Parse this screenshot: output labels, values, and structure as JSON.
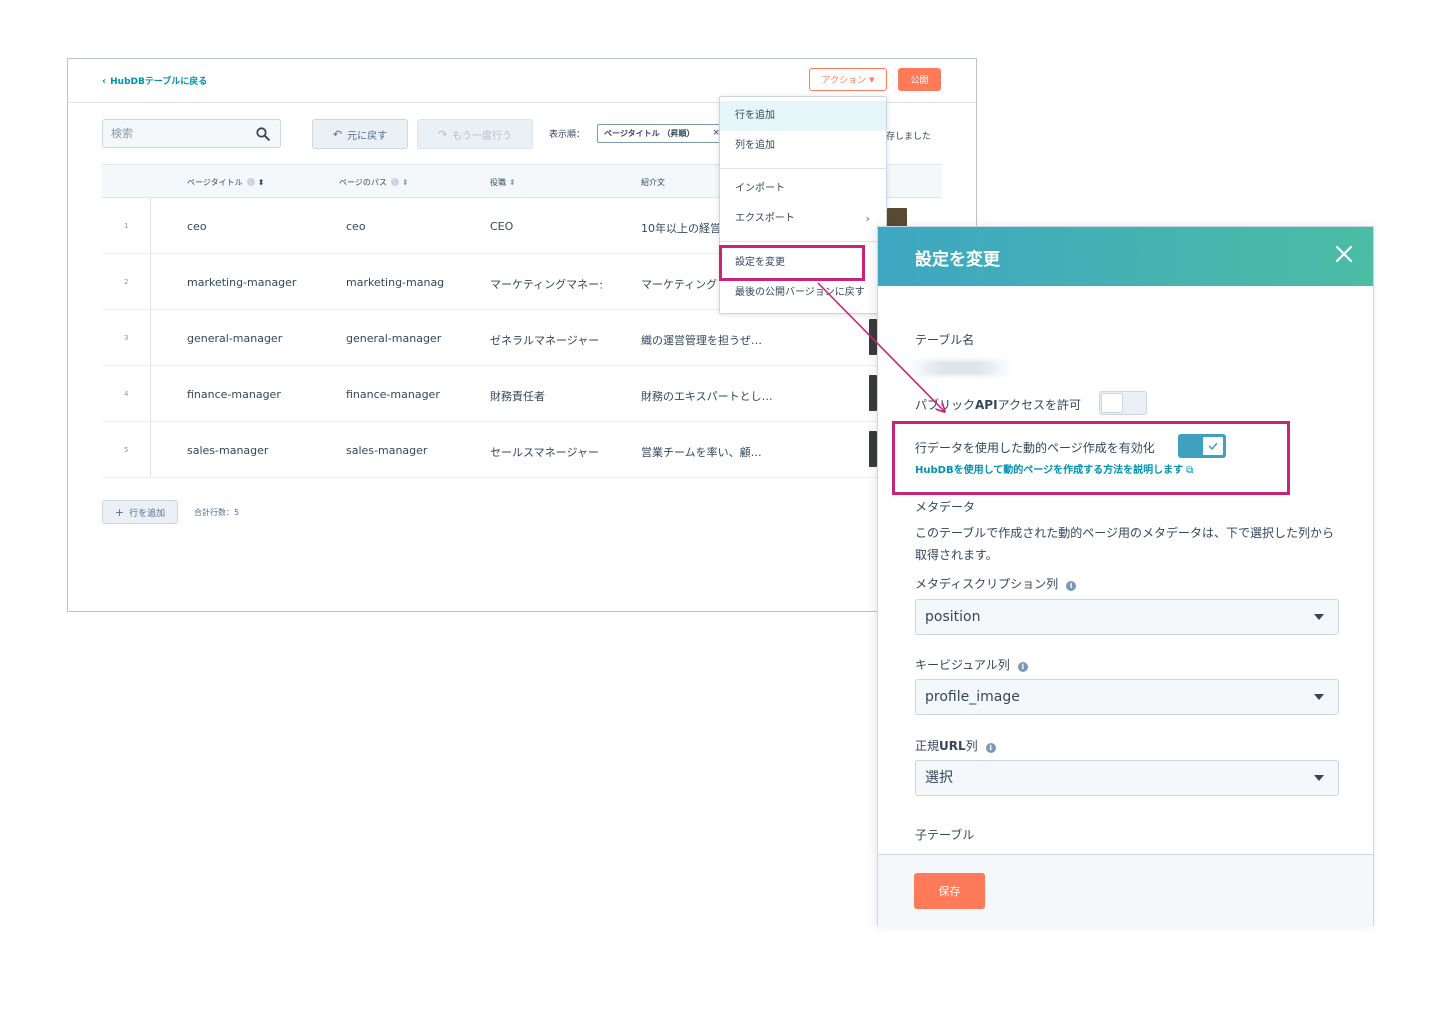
{
  "editor": {
    "back_link": "HubDBテーブルに戻る",
    "actions_label": "アクション",
    "publish_label": "公開",
    "search_placeholder": "検索",
    "undo_label": "元に戻す",
    "redo_label": "もう一度行う",
    "sort_label": "表示順：",
    "sort_value": "ページタイトル （昇順）",
    "saved_status": "存しました",
    "columns": [
      "ページタイトル",
      "ページのパス",
      "役職",
      "紹介文"
    ],
    "rows": [
      {
        "num": "1",
        "title": "ceo",
        "path": "ceo",
        "role": "CEO",
        "bio": "10年以上の経営"
      },
      {
        "num": "2",
        "title": "marketing-manager",
        "path": "marketing-manager",
        "role": "マーケティングマネージャー",
        "bio": "マーケティング"
      },
      {
        "num": "3",
        "title": "general-manager",
        "path": "general-manager",
        "role": "ゼネラルマネージャー",
        "bio": "織の運営管理を担うぜ…"
      },
      {
        "num": "4",
        "title": "finance-manager",
        "path": "finance-manager",
        "role": "財務責任者",
        "bio": "財務のエキスパートとし…"
      },
      {
        "num": "5",
        "title": "sales-manager",
        "path": "sales-manager",
        "role": "セールスマネージャー",
        "bio": "営業チームを率い、顧…"
      }
    ],
    "add_row_label": "行を追加",
    "total_rows": "合計行数：5"
  },
  "dropdown": {
    "items": [
      "行を追加",
      "列を追加",
      "インポート",
      "エクスポート",
      "設定を変更",
      "最後の公開バージョンに戻す"
    ]
  },
  "panel": {
    "title": "設定を変更",
    "table_name_label": "テーブル名",
    "public_api_label_pre": "パブリック",
    "public_api_label_bold": "API",
    "public_api_label_post": "アクセスを許可",
    "dynamic_label": "行データを使用した動的ページ作成を有効化",
    "help_link": "HubDBを使用して動的ページを作成する方法を説明します",
    "metadata_label": "メタデータ",
    "metadata_desc": "このテーブルで作成された動的ページ用のメタデータは、下で選択した列から取得されます。",
    "meta_desc_col_label": "メタディスクリプション列",
    "meta_desc_col_value": "position",
    "key_visual_label": "キービジュアル列",
    "key_visual_value": "profile_image",
    "canonical_label_pre": "正規",
    "canonical_label_bold": "URL",
    "canonical_label_post": "列",
    "canonical_value": "選択",
    "child_table_label": "子テーブル",
    "save_label": "保存",
    "public_api_enabled": false,
    "dynamic_enabled": true
  },
  "colors": {
    "accent": "#ff7a59",
    "link": "#0091ae",
    "highlight": "#c7247a",
    "header_gradient_start": "#3da7c2",
    "header_gradient_end": "#4bbda4"
  }
}
